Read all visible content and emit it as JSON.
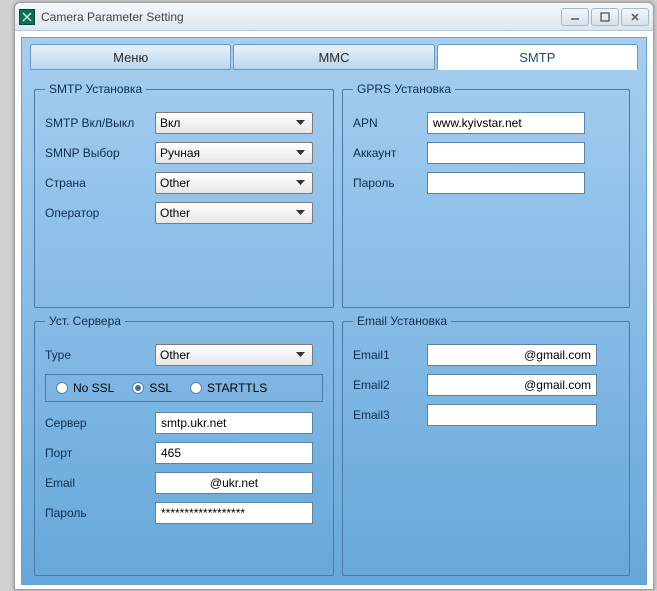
{
  "window": {
    "title": "Camera Parameter Setting"
  },
  "tabs": {
    "menu": "Меню",
    "mmc": "MMC",
    "smtp": "SMTP"
  },
  "smtp_group": {
    "legend": "SMTP Установка",
    "onoff_label": "SMTP Вкл/Выкл",
    "onoff_value": "Вкл",
    "smnp_label": "SMNP Выбор",
    "smnp_value": "Ручная",
    "country_label": "Страна",
    "country_value": "Other",
    "operator_label": "Оператор",
    "operator_value": "Other"
  },
  "gprs_group": {
    "legend": "GPRS Установка",
    "apn_label": "APN",
    "apn_value": "www.kyivstar.net",
    "account_label": "Аккаунт",
    "account_value": "",
    "password_label": "Пароль",
    "password_value": ""
  },
  "server_group": {
    "legend": "Уст. Сервера",
    "type_label": "Type",
    "type_value": "Other",
    "ssl_options": {
      "nossl": "No SSL",
      "ssl": "SSL",
      "starttls": "STARTTLS"
    },
    "server_label": "Сервер",
    "server_value": "smtp.ukr.net",
    "port_label": "Порт",
    "port_value": "465",
    "email_label": "Email",
    "email_value": "@ukr.net",
    "password_label": "Пароль",
    "password_value": "******************"
  },
  "email_group": {
    "legend": "Email Установка",
    "email1_label": "Email1",
    "email1_value": "@gmail.com",
    "email2_label": "Email2",
    "email2_value": "@gmail.com",
    "email3_label": "Email3",
    "email3_value": ""
  }
}
